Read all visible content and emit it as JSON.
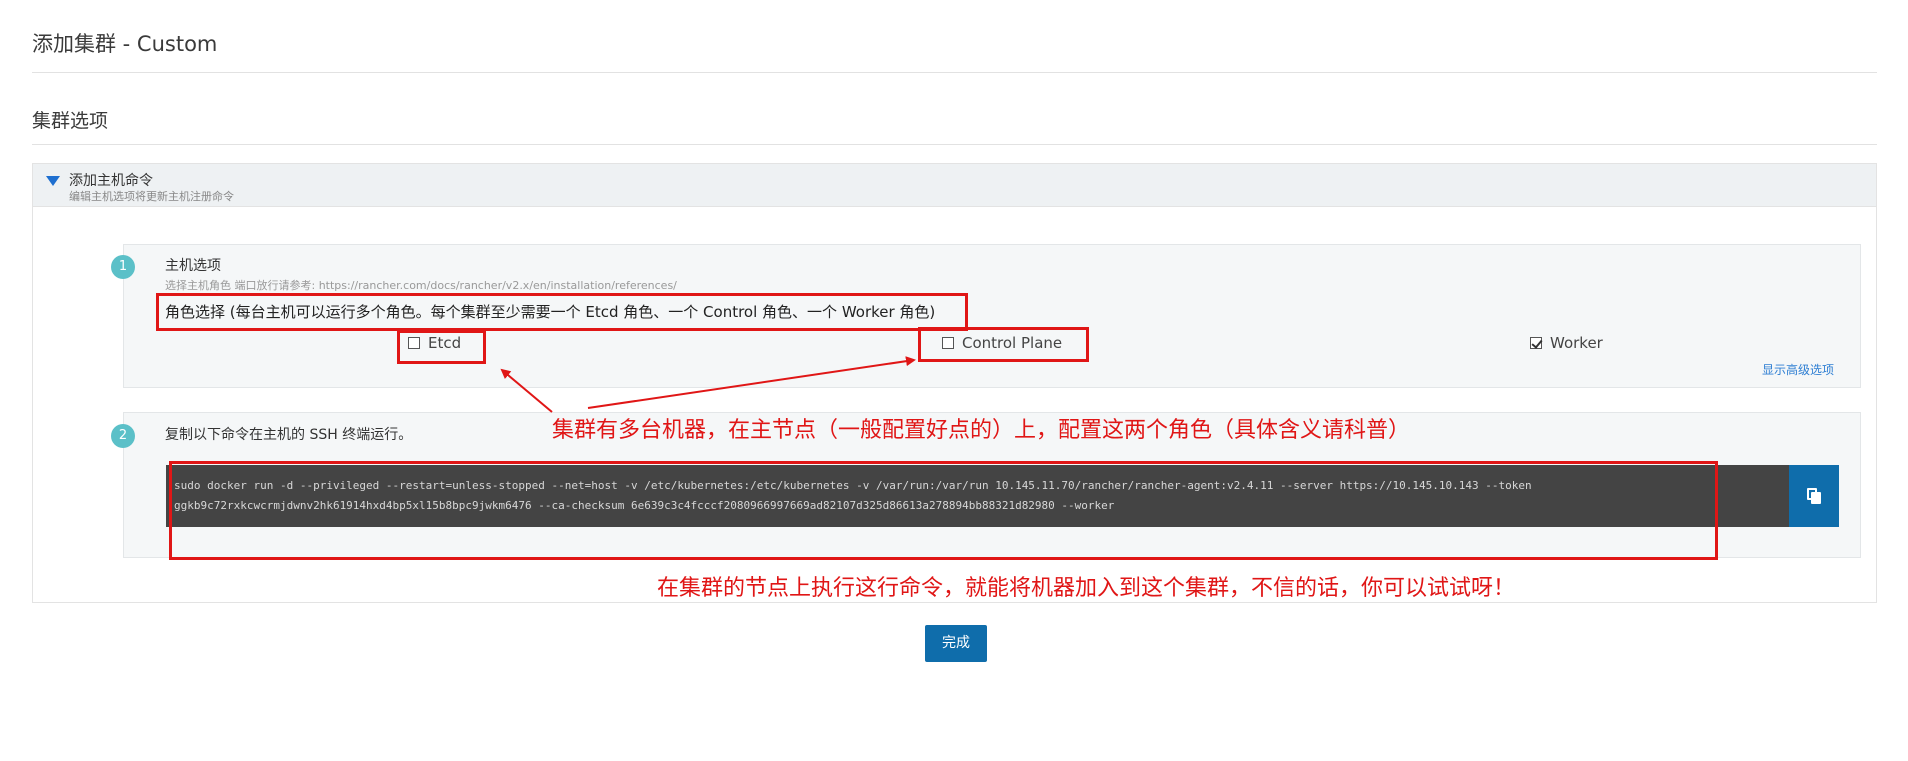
{
  "page": {
    "title": "添加集群 - Custom",
    "section_title": "集群选项"
  },
  "accordion": {
    "title": "添加主机命令",
    "subtitle": "编辑主机选项将更新主机注册命令"
  },
  "step1": {
    "number": "1",
    "title": "主机选项",
    "subtitle": "选择主机角色 端口放行请参考: https://rancher.com/docs/rancher/v2.x/en/installation/references/",
    "role_label": "角色选择 (每台主机可以运行多个角色。每个集群至少需要一个 Etcd 角色、一个 Control 角色、一个 Worker 角色)",
    "roles": [
      {
        "label": "Etcd",
        "checked": false
      },
      {
        "label": "Control Plane",
        "checked": false
      },
      {
        "label": "Worker",
        "checked": true
      }
    ],
    "advanced_link": "显示高级选项"
  },
  "step2": {
    "number": "2",
    "instruction": "复制以下命令在主机的 SSH 终端运行。",
    "command_line1": "sudo docker run -d --privileged --restart=unless-stopped --net=host -v /etc/kubernetes:/etc/kubernetes -v /var/run:/var/run 10.145.11.70/rancher/rancher-agent:v2.4.11 --server https://10.145.10.143 --token",
    "command_line2": "ggkb9c72rxkcwcrmjdwnv2hk61914hxd4bp5xl15b8bpc9jwkm6476 --ca-checksum 6e639c3c4fcccf2080966997669ad82107d325d86613a278894bb88321d82980 --worker"
  },
  "done_button": "完成",
  "annotations": {
    "roles_note": "集群有多台机器，在主节点（一般配置好点的）上，配置这两个角色（具体含义请科普）",
    "command_note": "在集群的节点上执行这行命令，就能将机器加入到这个集群，不信的话，你可以试试呀！",
    "color": "#e01616"
  },
  "colors": {
    "primary": "#0f6dab",
    "badge": "#5bc0c8",
    "code_bg": "#444444"
  }
}
